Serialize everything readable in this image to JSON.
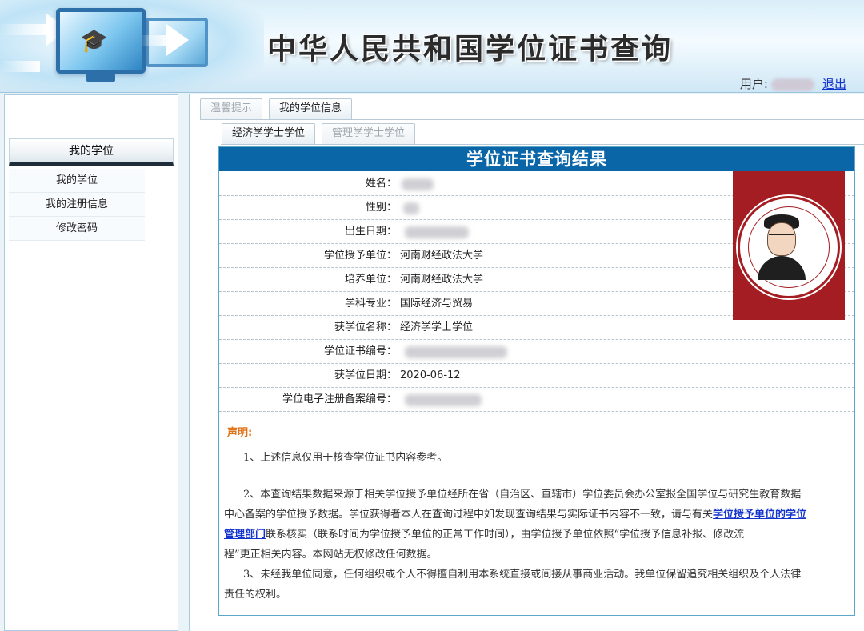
{
  "header": {
    "title": "中华人民共和国学位证书查询",
    "user_label": "用户:",
    "logout": "退出"
  },
  "sidebar": {
    "heading": "我的学位",
    "items": [
      {
        "label": "我的学位"
      },
      {
        "label": "我的注册信息"
      },
      {
        "label": "修改密码"
      }
    ]
  },
  "tabs": {
    "top": [
      {
        "label": "温馨提示",
        "active": false
      },
      {
        "label": "我的学位信息",
        "active": true
      }
    ],
    "sub": [
      {
        "label": "经济学学士学位",
        "active": true
      },
      {
        "label": "管理学学士学位",
        "active": false
      }
    ]
  },
  "result": {
    "title": "学位证书查询结果",
    "fields": [
      {
        "label": "姓名：",
        "value": ""
      },
      {
        "label": "性别：",
        "value": ""
      },
      {
        "label": "出生日期：",
        "value": ""
      },
      {
        "label": "学位授予单位：",
        "value": "河南财经政法大学"
      },
      {
        "label": "培养单位：",
        "value": "河南财经政法大学"
      },
      {
        "label": "学科专业：",
        "value": "国际经济与贸易"
      },
      {
        "label": "获学位名称：",
        "value": "经济学学士学位"
      },
      {
        "label": "学位证书编号：",
        "value": ""
      },
      {
        "label": "获学位日期：",
        "value": "2020-06-12"
      },
      {
        "label": "学位电子注册备案编号：",
        "value": ""
      }
    ],
    "photo": {
      "icon": "university-seal-avatar",
      "seal_color": "#a41d22"
    }
  },
  "declaration": {
    "title": "声明:",
    "item1": "1、上述信息仅用于核查学位证书内容参考。",
    "item2_line1": "2、本查询结果数据来源于相关学位授予单位经所在省（自治区、直辖市）学位委员会办公室报全国学位与研究生教育数据",
    "item2_line2a": "中心备案的学位授予数据。学位获得者本人在查询过程中如发现查询结果与实际证书内容不一致，请与有关",
    "item2_link_a": "学位授予单位的学位",
    "item2_link_b": "管理部门",
    "item2_line3b": "联系核实（联系时间为学位授予单位的正常工作时间），由学位授予单位依照“学位授予信息补报、修改流",
    "item2_line4": "程”更正相关内容。本网站无权修改任何数据。",
    "item3_line1": "3、未经我单位同意，任何组织或个人不得擅自利用本系统直接或间接从事商业活动。我单位保留追究相关组织及个人法律",
    "item3_line2": "责任的权利。"
  },
  "colors": {
    "title_bar": "#0b66a8",
    "declaration_title": "#e0741a",
    "link": "#1233cc"
  }
}
